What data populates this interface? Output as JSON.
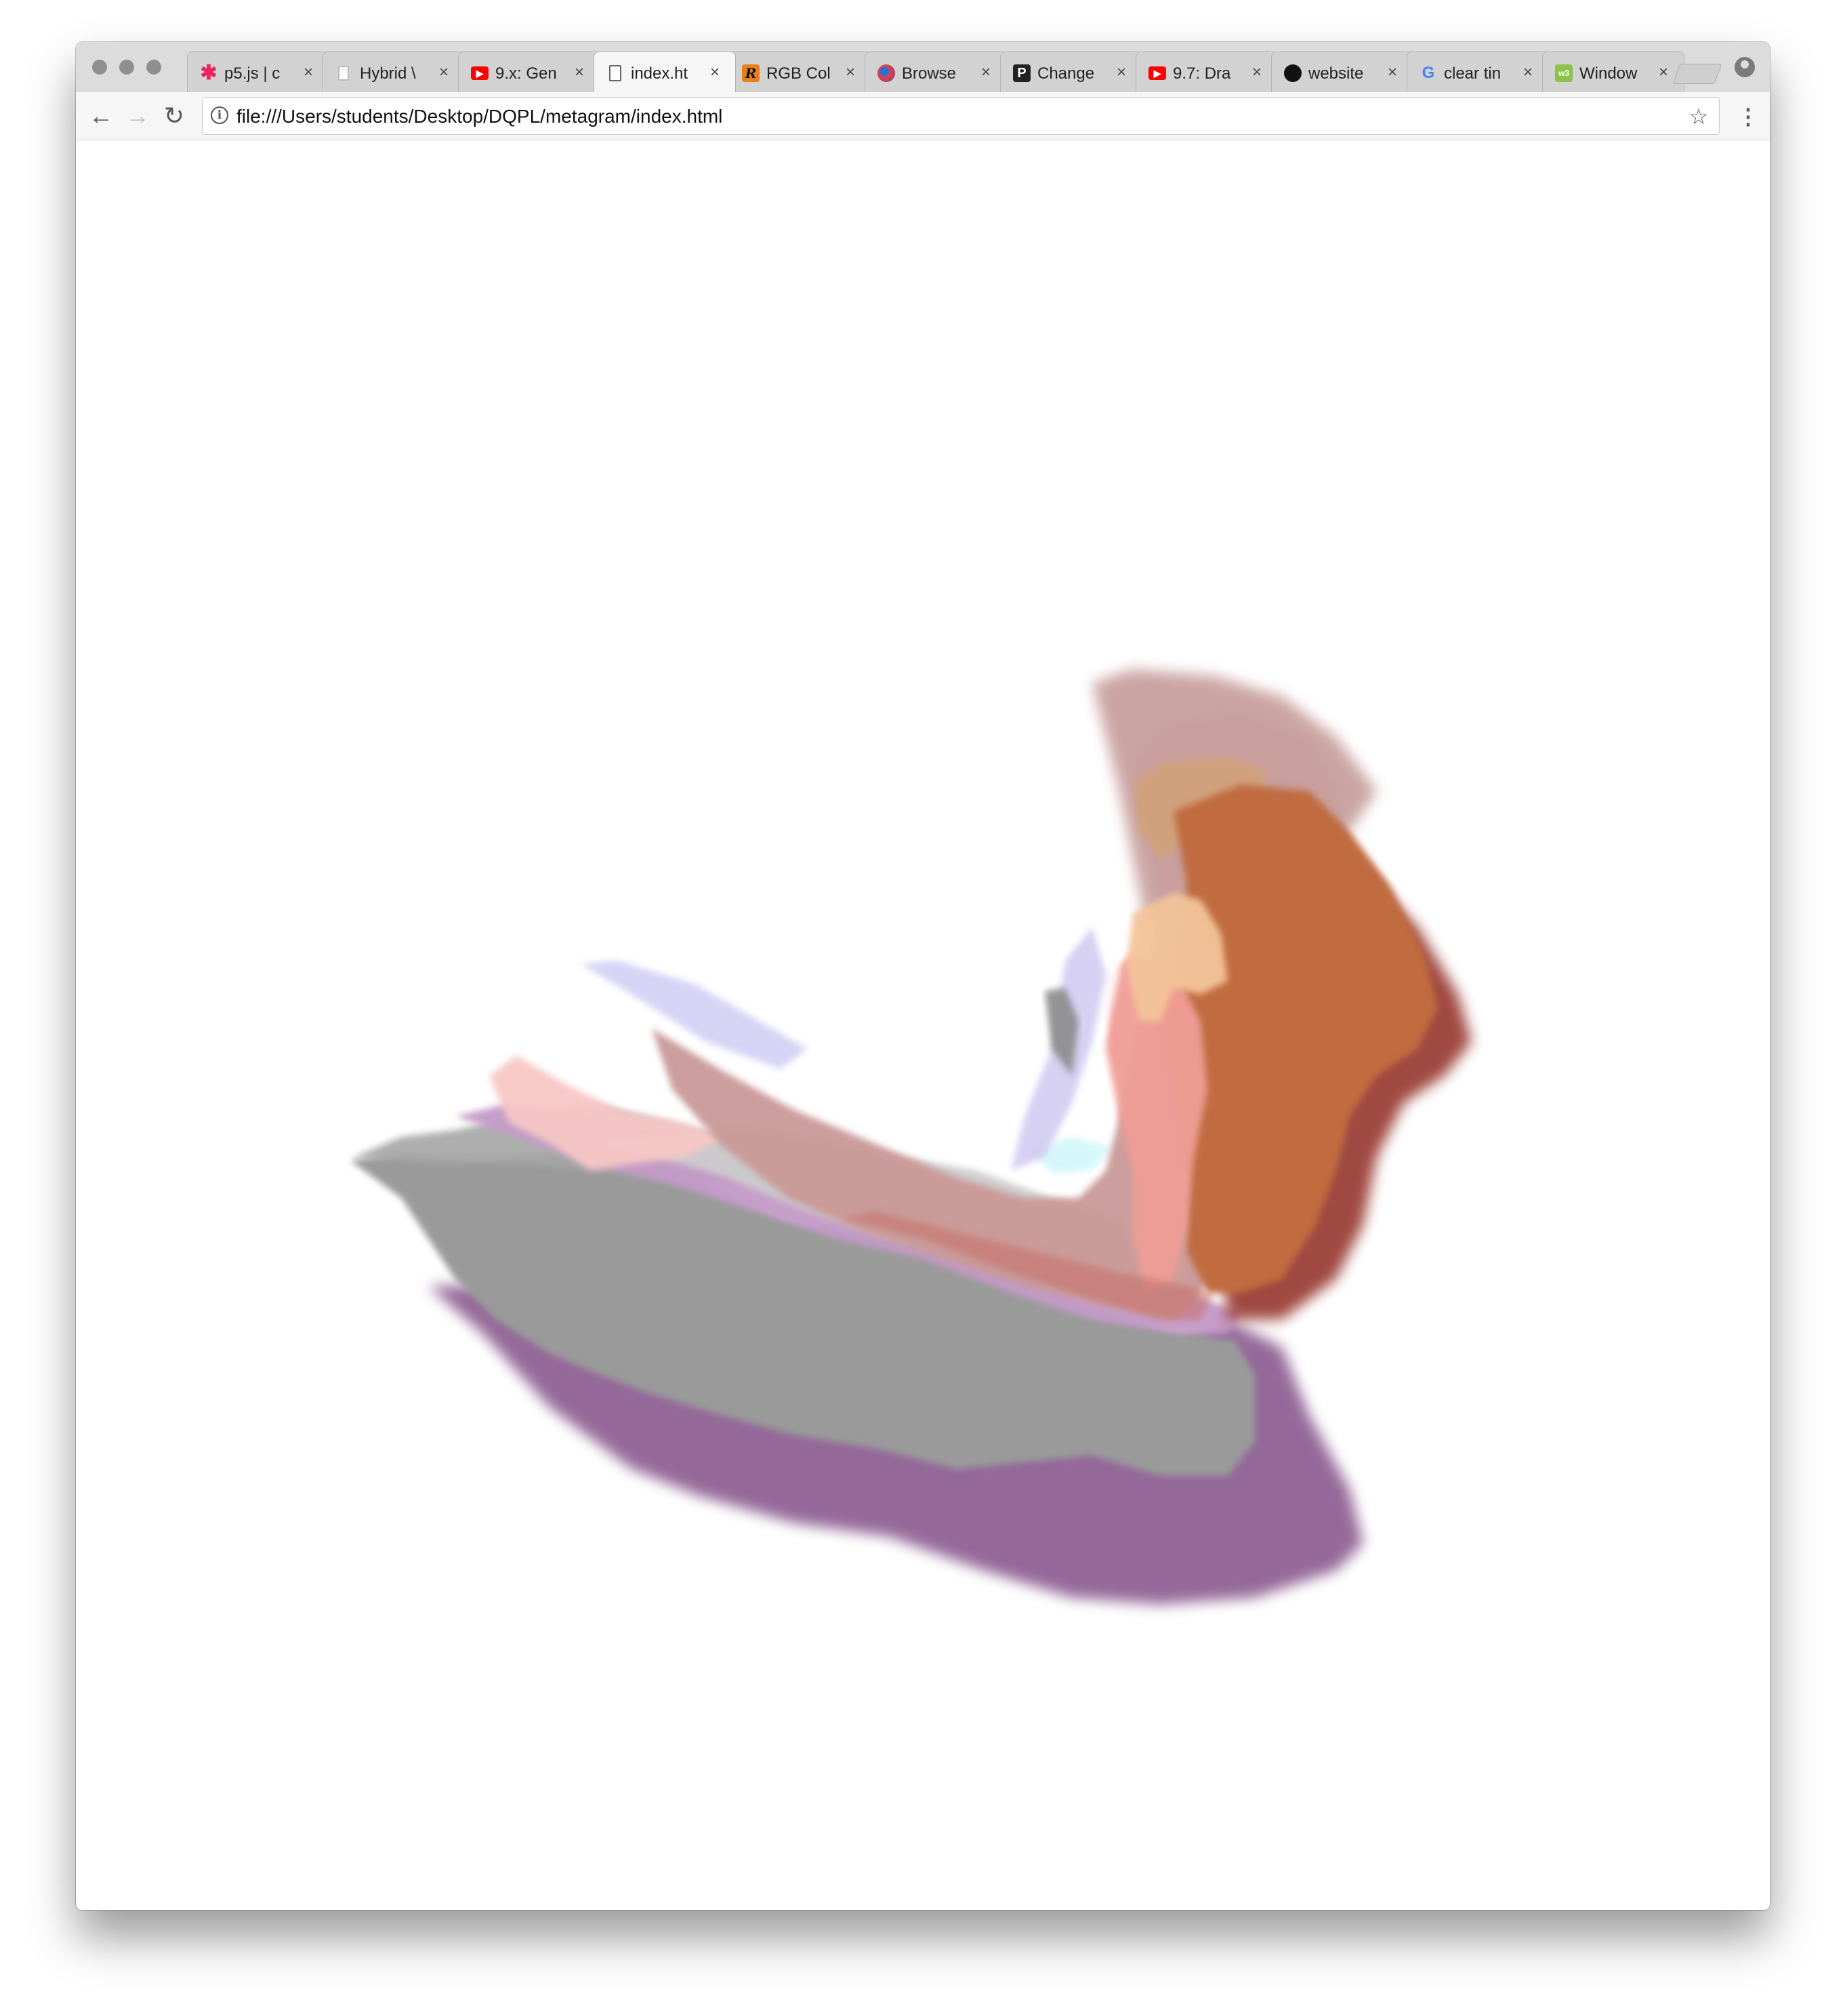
{
  "browser": {
    "tabs": [
      {
        "title": "p5.js | c",
        "icon": "p5js-asterisk-icon",
        "active": false
      },
      {
        "title": "Hybrid \\",
        "icon": "page-icon",
        "active": false
      },
      {
        "title": "9.x: Gen",
        "icon": "youtube-icon",
        "active": false
      },
      {
        "title": "index.ht",
        "icon": "document-icon",
        "active": true
      },
      {
        "title": "RGB Col",
        "icon": "r-icon",
        "active": false
      },
      {
        "title": "Browse",
        "icon": "browser-logo-icon",
        "active": false
      },
      {
        "title": "Change",
        "icon": "p-icon",
        "active": false
      },
      {
        "title": "9.7: Dra",
        "icon": "youtube-icon",
        "active": false
      },
      {
        "title": "website",
        "icon": "github-icon",
        "active": false
      },
      {
        "title": "clear tin",
        "icon": "google-icon",
        "active": false
      },
      {
        "title": "Window",
        "icon": "w3-icon",
        "active": false
      }
    ],
    "close_glyph": "×",
    "url": "file:///Users/students/Desktop/DQPL/metagram/index.html",
    "nav": {
      "back": "←",
      "forward": "→",
      "reload": "↻",
      "info": "i",
      "star": "☆",
      "menu": "⋮"
    },
    "colors": {
      "tabstrip": "#dcdcdc",
      "toolbar": "#f6f6f6",
      "youtube": "#ff0000",
      "p5": "#ed225d",
      "rgb": "#e8801a"
    }
  },
  "artwork": {
    "description_colors": [
      "#9a9a9a",
      "#8c5d91",
      "#c49ac8",
      "#c99a98",
      "#c06c40",
      "#9b3f38",
      "#f3b8b5",
      "#cccccc"
    ]
  }
}
